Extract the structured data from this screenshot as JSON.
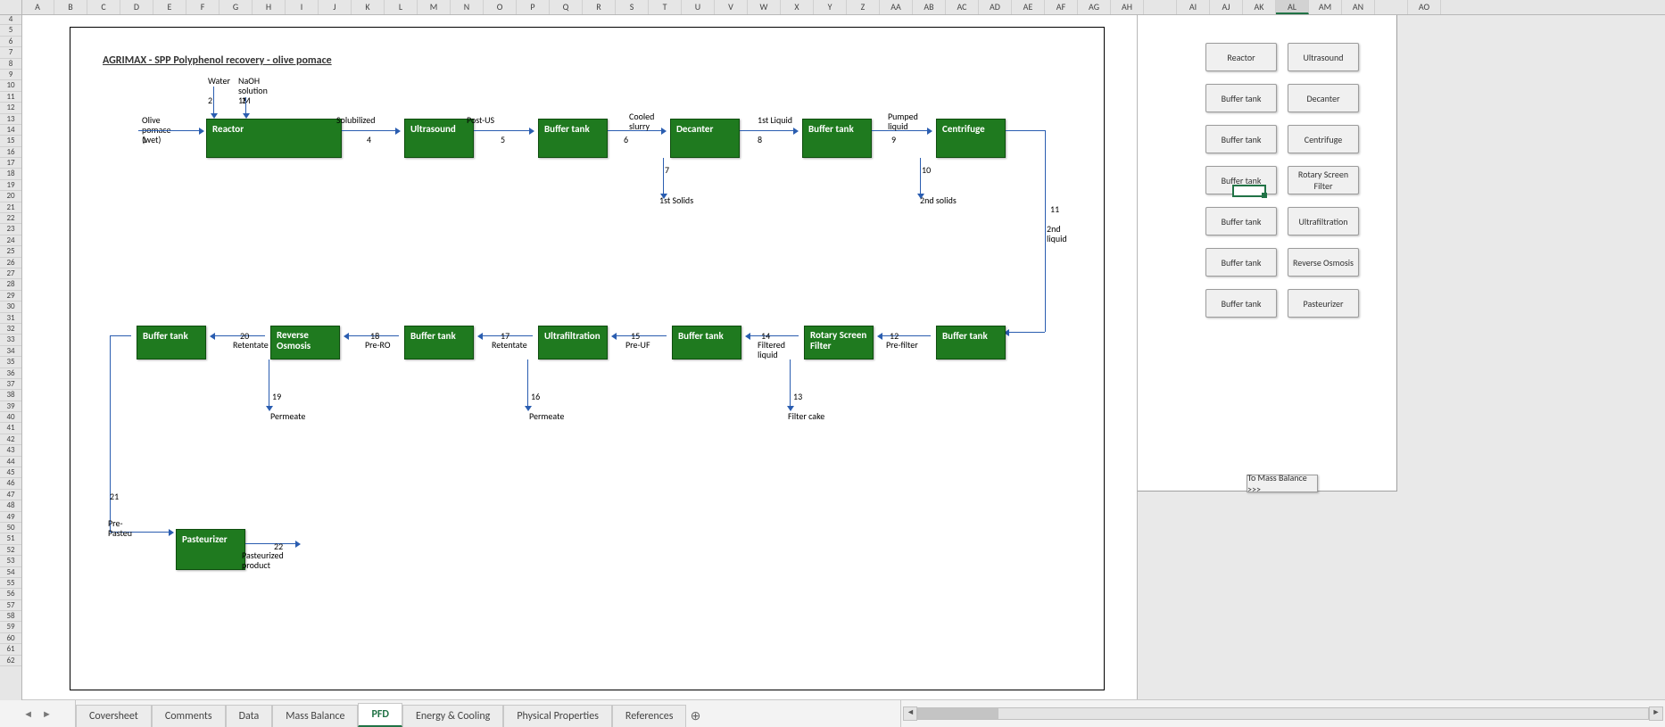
{
  "columns": [
    "A",
    "B",
    "C",
    "D",
    "E",
    "F",
    "G",
    "H",
    "I",
    "J",
    "K",
    "L",
    "M",
    "N",
    "O",
    "P",
    "Q",
    "R",
    "S",
    "T",
    "U",
    "V",
    "W",
    "X",
    "Y",
    "Z",
    "AA",
    "AB",
    "AC",
    "AD",
    "AE",
    "AF",
    "AG",
    "AH",
    "",
    "AI",
    "AJ",
    "AK",
    "AL",
    "AM",
    "AN",
    "",
    "AO"
  ],
  "selected_column_index": 38,
  "row_start": 4,
  "row_end": 62,
  "selected_cell": {
    "col": 38,
    "row_index": 21
  },
  "title": "AGRIMAX - SPP Polyphenol recovery - olive pomace",
  "blocks_top": [
    {
      "name": "reactor",
      "label": "Reactor"
    },
    {
      "name": "ultrasound",
      "label": "Ultrasound"
    },
    {
      "name": "buffer-tank-1",
      "label": "Buffer tank"
    },
    {
      "name": "decanter",
      "label": "Decanter"
    },
    {
      "name": "buffer-tank-2",
      "label": "Buffer tank"
    },
    {
      "name": "centrifuge",
      "label": "Centrifuge"
    }
  ],
  "blocks_mid": [
    {
      "name": "buffer-tank-7",
      "label": "Buffer tank"
    },
    {
      "name": "reverse-osmosis",
      "label": "Reverse Osmosis"
    },
    {
      "name": "buffer-tank-6",
      "label": "Buffer tank"
    },
    {
      "name": "ultrafiltration",
      "label": "Ultrafiltration"
    },
    {
      "name": "buffer-tank-5",
      "label": "Buffer tank"
    },
    {
      "name": "rotary-screen",
      "label": "Rotary Screen Filter"
    },
    {
      "name": "buffer-tank-4",
      "label": "Buffer tank"
    }
  ],
  "blocks_bot": [
    {
      "name": "pasteurizer",
      "label": "Pasteurizer"
    }
  ],
  "streams": {
    "feed": {
      "label": "Olive pomace (wet)",
      "num": "1"
    },
    "water": {
      "label": "Water",
      "num": "2"
    },
    "naoh": {
      "label": "NaOH solution 1M",
      "num": "3"
    },
    "s4": {
      "label": "Solubilized",
      "num": "4"
    },
    "s5": {
      "label": "Post-US",
      "num": "5"
    },
    "s6": {
      "label": "Cooled slurry",
      "num": "6"
    },
    "s7": {
      "label": "1st Solids",
      "num": "7"
    },
    "s8": {
      "label": "1st Liquid",
      "num": "8"
    },
    "s9": {
      "label": "Pumped liquid",
      "num": "9"
    },
    "s10": {
      "label": "2nd solids",
      "num": "10"
    },
    "s11": {
      "label": "2nd liquid",
      "num": "11"
    },
    "s12": {
      "label": "Pre-filter",
      "num": "12"
    },
    "s13": {
      "label": "Filter cake",
      "num": "13"
    },
    "s14": {
      "label": "Filtered liquid",
      "num": "14"
    },
    "s15": {
      "label": "Pre-UF",
      "num": "15"
    },
    "s16": {
      "label": "Permeate",
      "num": "16"
    },
    "s17": {
      "label": "Retentate",
      "num": "17"
    },
    "s18": {
      "label": "Pre-RO",
      "num": "18"
    },
    "s19": {
      "label": "Permeate",
      "num": "19"
    },
    "s20": {
      "label": "Retentate",
      "num": "20"
    },
    "s21": {
      "label": "Pre-Pasteu",
      "num": "21"
    },
    "s22": {
      "label": "Pasteurized product",
      "num": "22"
    }
  },
  "panel_buttons": [
    [
      "Reactor",
      "Ultrasound"
    ],
    [
      "Buffer tank",
      "Decanter"
    ],
    [
      "Buffer tank",
      "Centrifuge"
    ],
    [
      "Buffer tank",
      "Rotary Screen Filter"
    ],
    [
      "Buffer tank",
      "Ultrafiltration"
    ],
    [
      "Buffer tank",
      "Reverse Osmosis"
    ],
    [
      "Buffer tank",
      "Pasteurizer"
    ]
  ],
  "mass_balance_btn": "To Mass Balance >>>",
  "tabs": [
    "Coversheet",
    "Comments",
    "Data",
    "Mass Balance",
    "PFD",
    "Energy & Cooling",
    "Physical Properties",
    "References"
  ],
  "active_tab_index": 4
}
